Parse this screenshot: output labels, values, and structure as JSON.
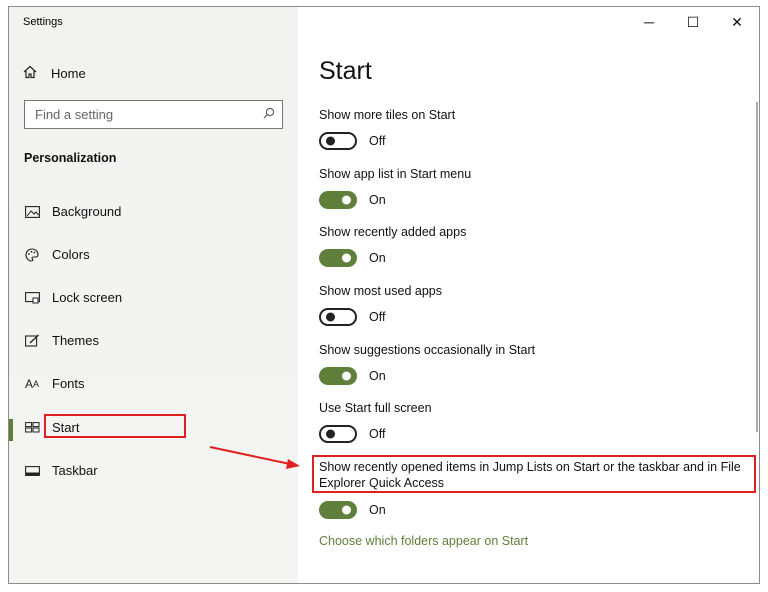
{
  "window": {
    "title": "Settings"
  },
  "controls": {
    "minimize": "─",
    "maximize": "☐",
    "close": "✕"
  },
  "sidebar": {
    "home_label": "Home",
    "search_placeholder": "Find a setting",
    "section": "Personalization",
    "items": [
      {
        "label": "Background",
        "icon": "image-icon"
      },
      {
        "label": "Colors",
        "icon": "palette-icon"
      },
      {
        "label": "Lock screen",
        "icon": "lock-screen-icon"
      },
      {
        "label": "Themes",
        "icon": "themes-icon"
      },
      {
        "label": "Fonts",
        "icon": "fonts-icon"
      },
      {
        "label": "Start",
        "icon": "start-icon",
        "selected": true
      },
      {
        "label": "Taskbar",
        "icon": "taskbar-icon"
      }
    ]
  },
  "main": {
    "title": "Start",
    "settings": [
      {
        "label": "Show more tiles on Start",
        "state": "Off"
      },
      {
        "label": "Show app list in Start menu",
        "state": "On"
      },
      {
        "label": "Show recently added apps",
        "state": "On"
      },
      {
        "label": "Show most used apps",
        "state": "Off"
      },
      {
        "label": "Show suggestions occasionally in Start",
        "state": "On"
      },
      {
        "label": "Use Start full screen",
        "state": "Off"
      },
      {
        "label": "Show recently opened items in Jump Lists on Start or the taskbar and in File Explorer Quick Access",
        "state": "On"
      }
    ],
    "link": "Choose which folders appear on Start"
  },
  "colors": {
    "accent": "#5f7f3a",
    "highlight": "#e02020"
  }
}
